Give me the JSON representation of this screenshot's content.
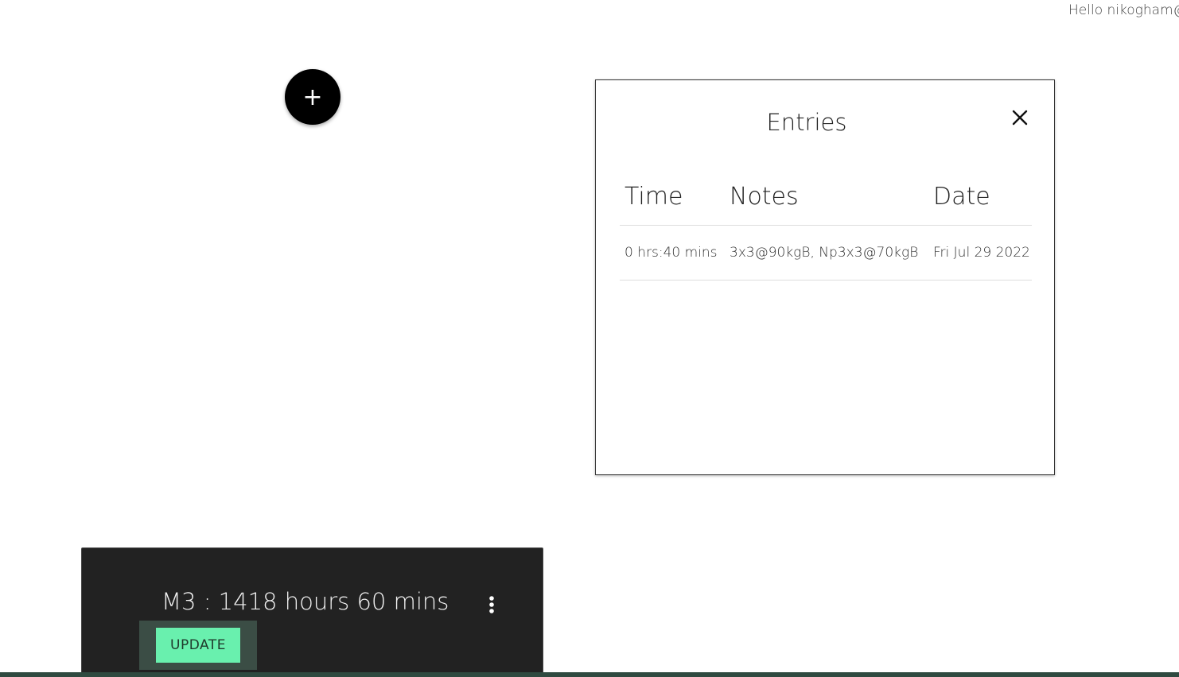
{
  "header": {
    "greeting": "Hello nikogham@"
  },
  "add_button": {
    "label": "+"
  },
  "entries_modal": {
    "title": "Entries",
    "close_icon": "close-icon",
    "columns": [
      "Time",
      "Notes",
      "Date"
    ],
    "rows": [
      {
        "time": "0 hrs:40 mins",
        "notes": "3x3@90kgB, Np3x3@70kgB",
        "date": "Fri Jul 29 2022"
      }
    ]
  },
  "machine_card": {
    "title": "M3 : 1418 hours 60 mins",
    "menu_icon": "more-vert-icon",
    "update_label": "UPDATE"
  },
  "colors": {
    "card_bg": "#222222",
    "accent_green": "#69f0ae",
    "footer_strip": "#2f4a40"
  }
}
